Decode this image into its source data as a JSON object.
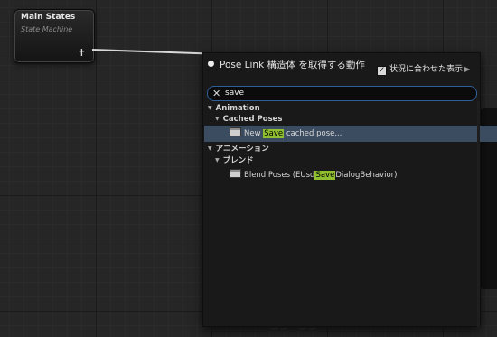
{
  "graph": {
    "node_title": "Main States",
    "node_subtitle": "State Machine",
    "background_text": "∽∽ ∽∽"
  },
  "menu": {
    "title": "Pose Link 構造体 を取得する動作",
    "context_label": "状況に合わせた表示",
    "context_checked": true,
    "search": {
      "value": "save",
      "placeholder": ""
    },
    "categories": [
      {
        "label": "Animation"
      },
      {
        "label": "Cached Poses"
      },
      {
        "label": "アニメーション"
      },
      {
        "label": "ブレンド"
      }
    ],
    "items": [
      {
        "pre": "New ",
        "highlight": "Save",
        "post": " cached pose...",
        "selected": true
      },
      {
        "pre": "Blend Poses (EUsd",
        "highlight": "Save",
        "post": "DialogBehavior)",
        "selected": false
      }
    ]
  },
  "colors": {
    "highlight": "#8fbf30",
    "selection": "#3c4c60",
    "search_border": "#2f5f9a"
  }
}
